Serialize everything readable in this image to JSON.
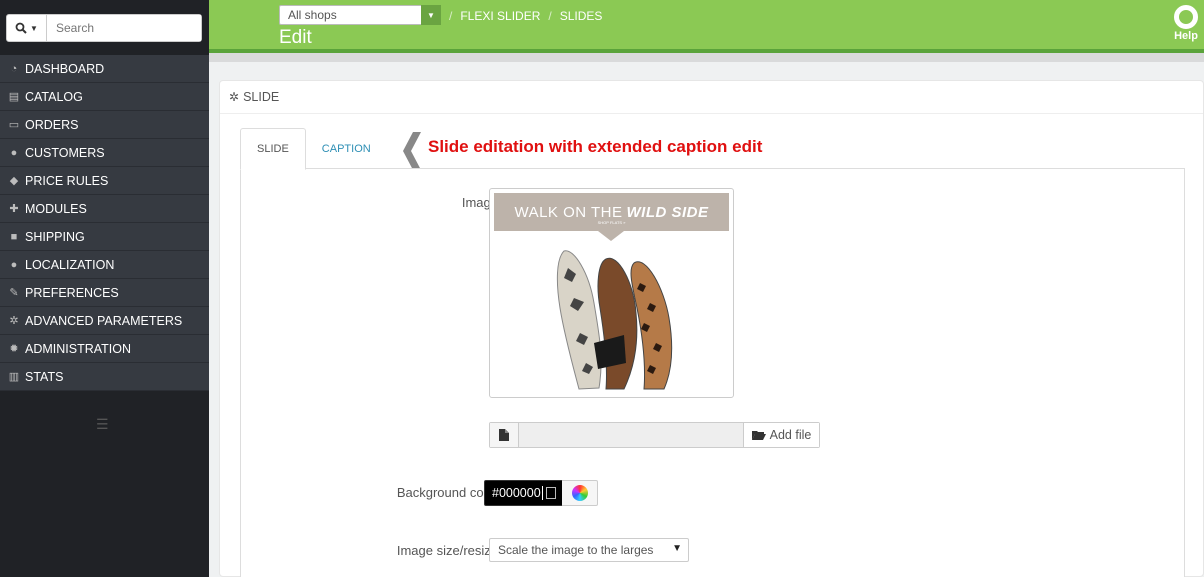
{
  "search": {
    "placeholder": "Search"
  },
  "sidebar": {
    "items": [
      {
        "label": "DASHBOARD",
        "icon": "dashboard-icon"
      },
      {
        "label": "CATALOG",
        "icon": "book-icon"
      },
      {
        "label": "ORDERS",
        "icon": "credit-card-icon"
      },
      {
        "label": "CUSTOMERS",
        "icon": "users-icon"
      },
      {
        "label": "PRICE RULES",
        "icon": "tags-icon"
      },
      {
        "label": "MODULES",
        "icon": "puzzle-icon"
      },
      {
        "label": "SHIPPING",
        "icon": "truck-icon"
      },
      {
        "label": "LOCALIZATION",
        "icon": "globe-icon"
      },
      {
        "label": "PREFERENCES",
        "icon": "wrench-icon"
      },
      {
        "label": "ADVANCED PARAMETERS",
        "icon": "cogs-icon"
      },
      {
        "label": "ADMINISTRATION",
        "icon": "gear-icon"
      },
      {
        "label": "STATS",
        "icon": "bar-chart-icon"
      }
    ]
  },
  "header": {
    "shop_select": "All shops",
    "breadcrumb": [
      "FLEXI SLIDER",
      "SLIDES"
    ],
    "title": "Edit",
    "help_label": "Help"
  },
  "panel": {
    "heading": "SLIDE",
    "tabs": [
      {
        "label": "SLIDE",
        "active": true
      },
      {
        "label": "CAPTION",
        "active": false
      }
    ],
    "annotation": "Slide editation with extended caption edit"
  },
  "form": {
    "image_label": "Image",
    "image_banner_text": "WALK ON THE",
    "image_banner_bold": "WILD SIDE",
    "image_banner_sub": "SHOP FLATS »",
    "add_file_label": "Add file",
    "bg_color_label": "Background color",
    "bg_color_value": "#000000",
    "size_label": "Image size/resize",
    "size_value": "Scale the image to the larges"
  },
  "colors": {
    "header_green": "#8bc954",
    "sidebar_dark": "#363a41",
    "annotation_red": "#e01010",
    "link_blue": "#2e8fb5"
  }
}
